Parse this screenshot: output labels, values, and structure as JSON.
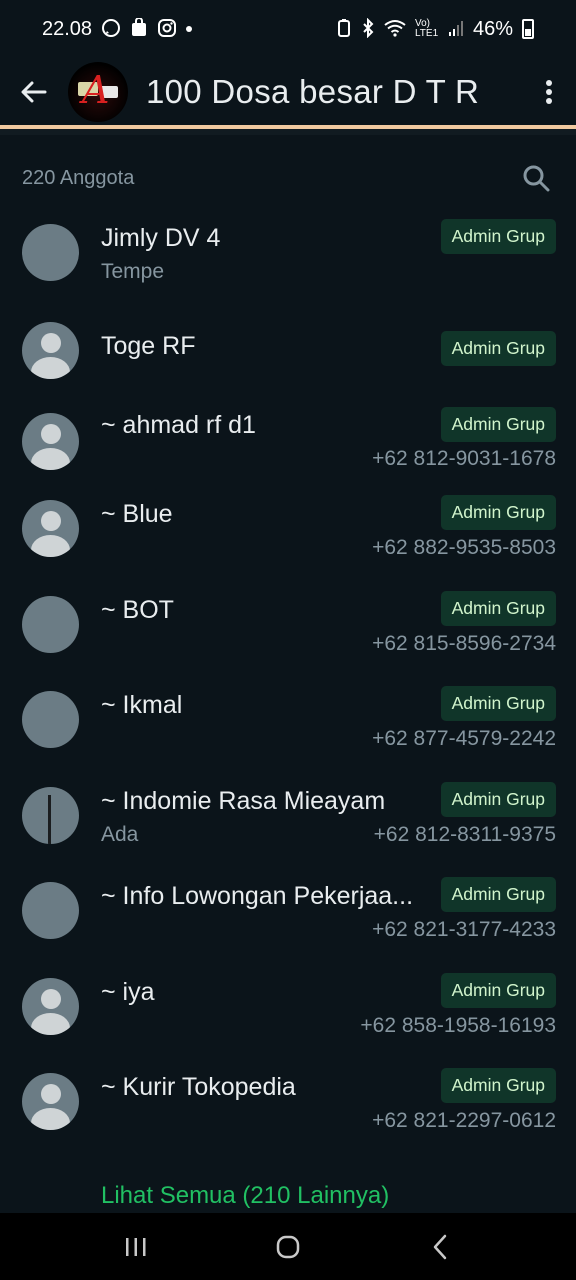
{
  "status_bar": {
    "time": "22.08",
    "battery": "46%",
    "network_label": "Vo) LTE1"
  },
  "header": {
    "title": "100 Dosa besar D T R",
    "accent_color": "#f0c9a0"
  },
  "members": {
    "count_label": "220 Anggota",
    "badge_color": "#103529",
    "items": [
      {
        "name": "Jimly DV 4",
        "about": "Tempe",
        "badge": "Admin Grup",
        "phone": ""
      },
      {
        "name": "Toge RF",
        "about": "",
        "badge": "Admin Grup",
        "phone": ""
      },
      {
        "name": "~ ahmad rf d1",
        "about": "",
        "badge": "Admin Grup",
        "phone": "+62 812-9031-1678"
      },
      {
        "name": "~ Blue",
        "about": "",
        "badge": "Admin Grup",
        "phone": "+62 882-9535-8503"
      },
      {
        "name": "~ BOT",
        "about": "",
        "badge": "Admin Grup",
        "phone": "+62 815-8596-2734"
      },
      {
        "name": "~ Ikmal",
        "about": "",
        "badge": "Admin Grup",
        "phone": "+62 877-4579-2242"
      },
      {
        "name": "~ Indomie Rasa Mieayam",
        "about": "Ada",
        "badge": "Admin Grup",
        "phone": "+62 812-8311-9375"
      },
      {
        "name": "~ Info Lowongan Pekerjaa...",
        "about": "",
        "badge": "Admin Grup",
        "phone": "+62 821-3177-4233"
      },
      {
        "name": "~ iya",
        "about": "",
        "badge": "Admin Grup",
        "phone": "+62 858-1958-16193"
      },
      {
        "name": "~ Kurir Tokopedia",
        "about": "",
        "badge": "Admin Grup",
        "phone": "+62 821-2297-0612"
      }
    ],
    "see_all": "Lihat Semua (210 Lainnya)",
    "see_all_color": "#21c063"
  },
  "icons": {
    "back": "arrow-left-icon",
    "more": "more-vertical-icon",
    "search": "search-icon",
    "nav_recents": "recents-icon",
    "nav_home": "home-icon",
    "nav_back": "chevron-left-icon"
  }
}
